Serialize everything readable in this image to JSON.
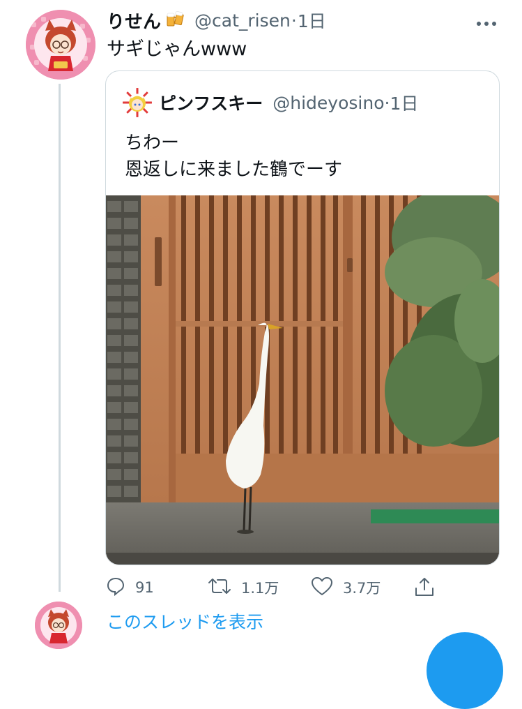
{
  "tweet": {
    "display_name": "りせん",
    "name_emoji": "beer-mugs-icon",
    "handle": "@cat_risen",
    "separator": "·",
    "time": "1日",
    "text": "サギじゃんwww",
    "avatar": "cat-girl-avatar"
  },
  "quoted_tweet": {
    "display_name": "ピンフスキー",
    "handle": "@hideyosino",
    "separator": "·",
    "time": "1日",
    "lines": [
      "ちわー",
      "恩返しに来ました鶴でーす"
    ],
    "photo": "egret-in-front-of-wooden-gate"
  },
  "actions": {
    "reply_count": "91",
    "retweet_count": "1.1万",
    "like_count": "3.7万"
  },
  "thread": {
    "show_thread_label": "このスレッドを表示"
  },
  "colors": {
    "accent": "#1d9bf0",
    "text_primary": "#0f1419",
    "text_secondary": "#536471",
    "border": "#cfd9de"
  }
}
